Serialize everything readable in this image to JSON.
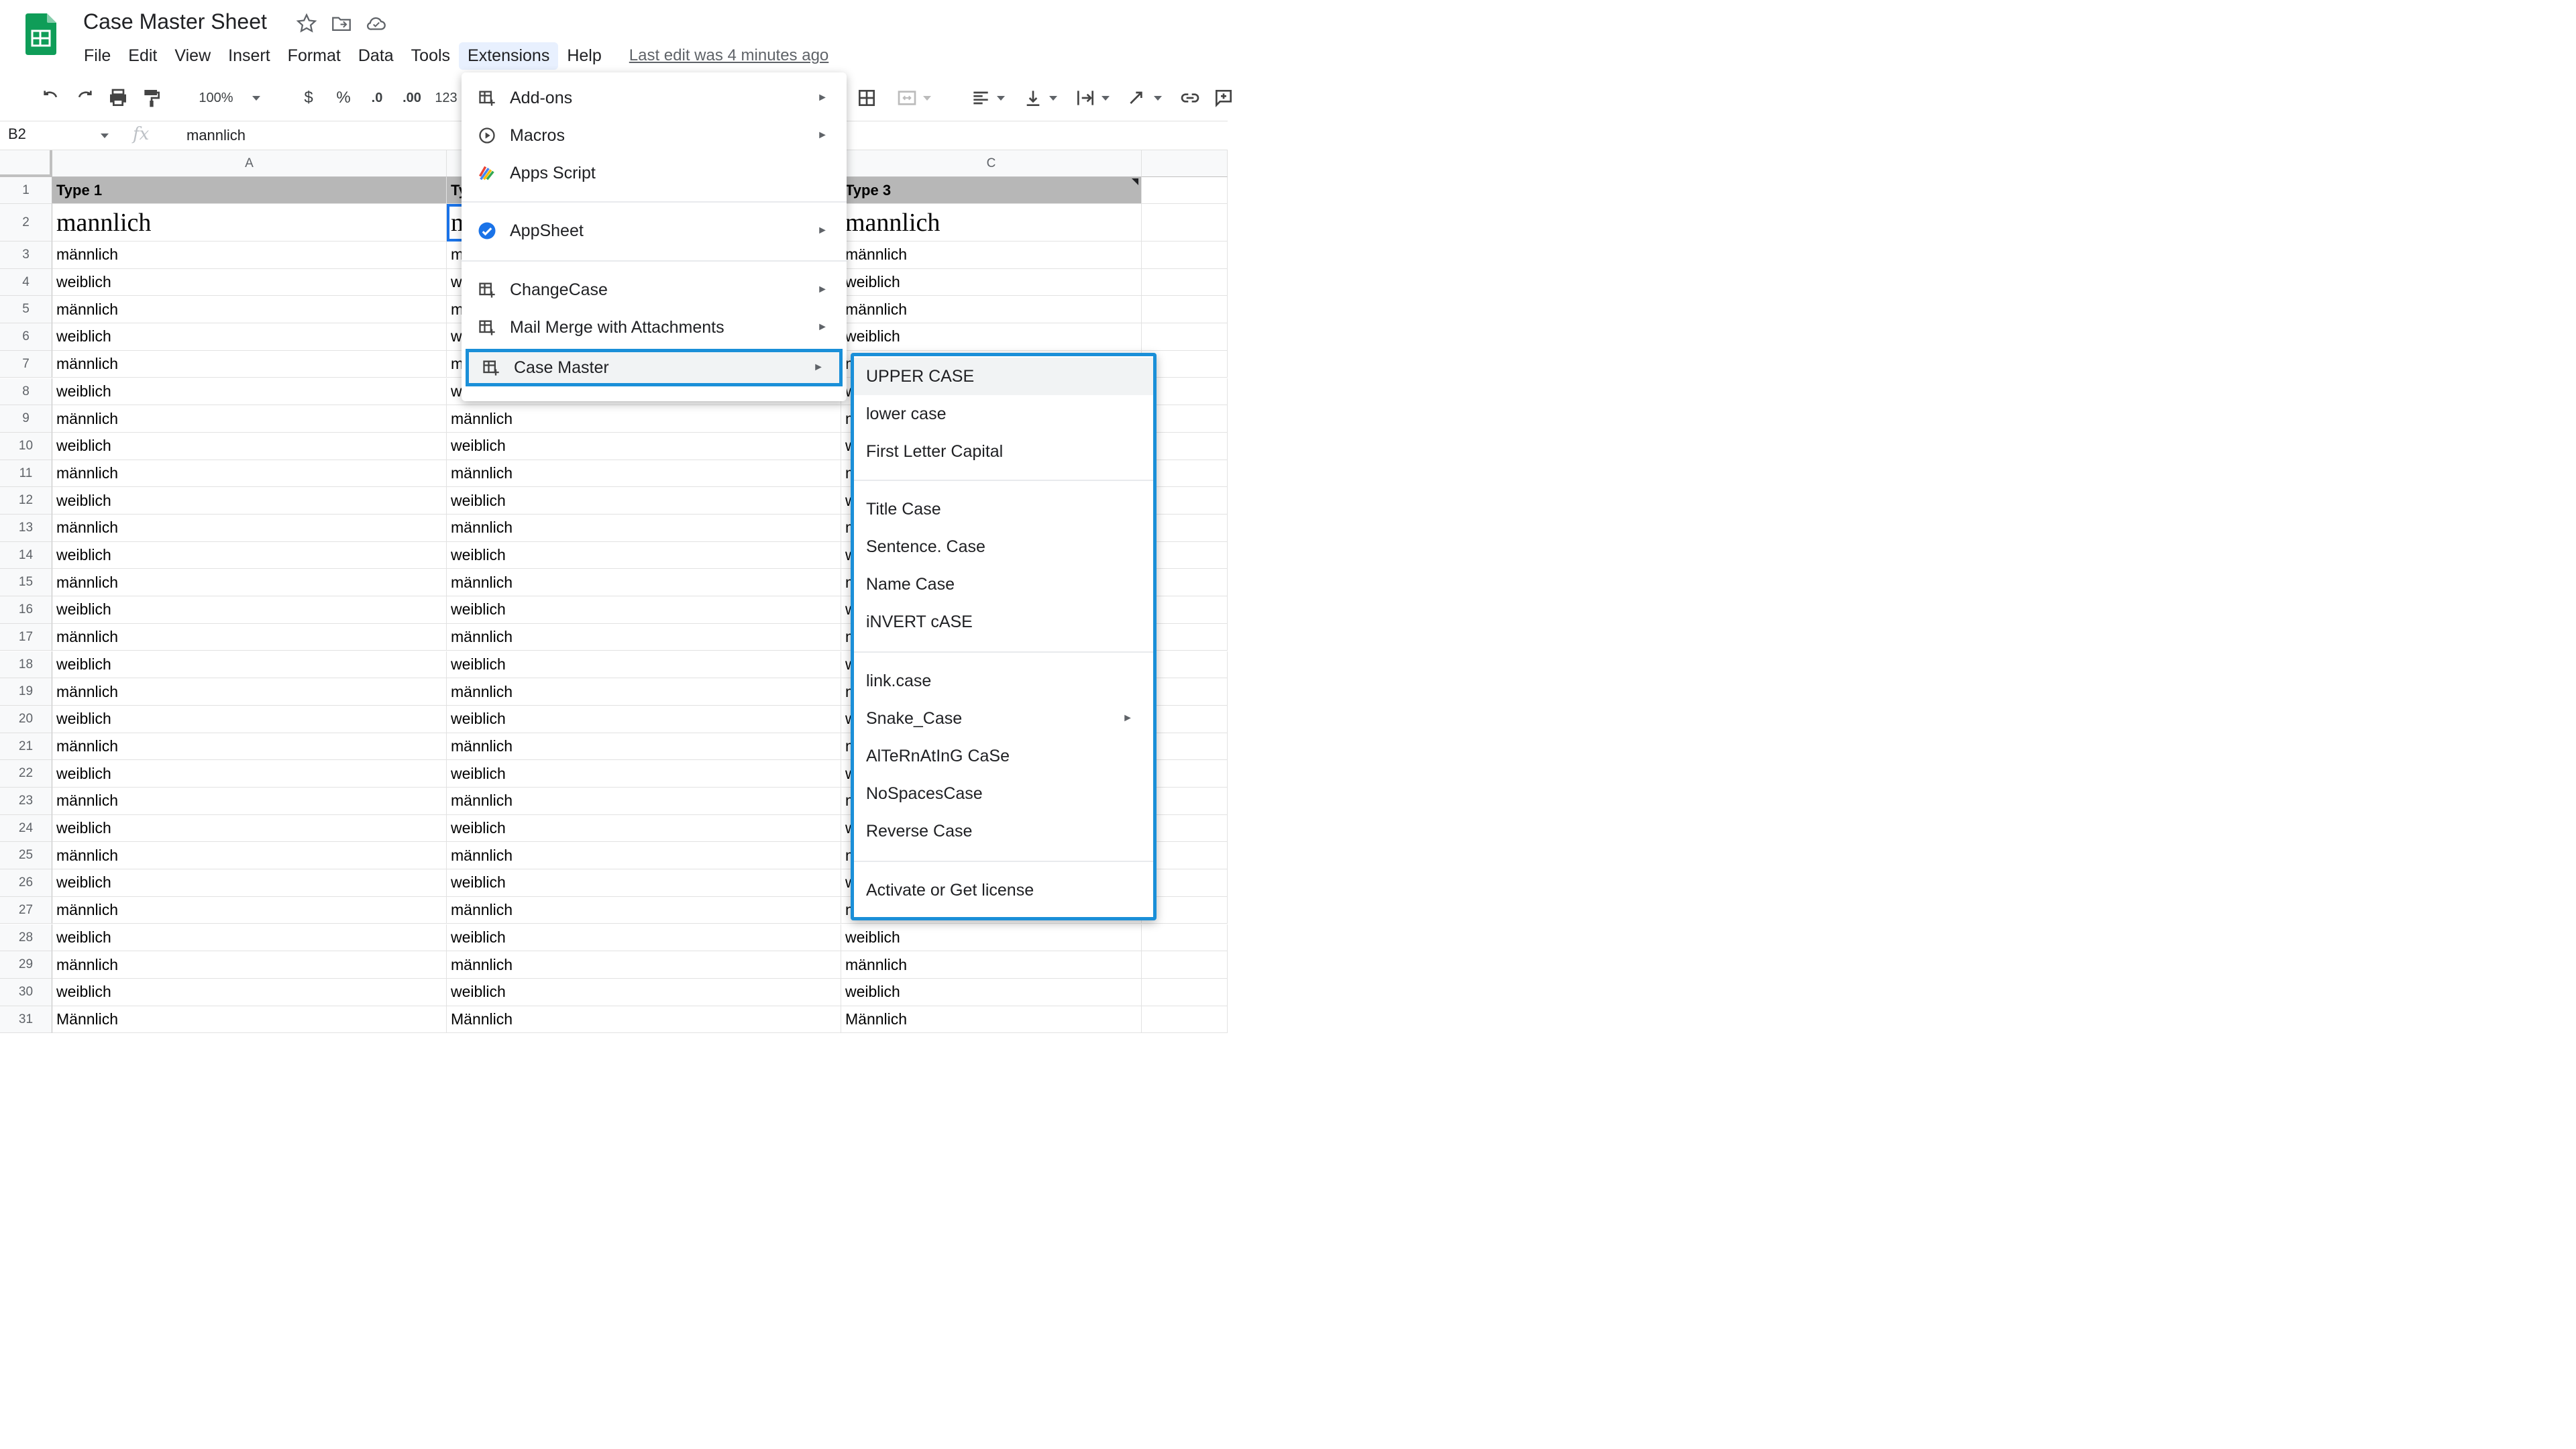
{
  "app": {
    "title": "Case Master Sheet",
    "last_edit": "Last edit was 4 minutes ago"
  },
  "menubar": [
    "File",
    "Edit",
    "View",
    "Insert",
    "Format",
    "Data",
    "Tools",
    "Extensions",
    "Help"
  ],
  "toolbar": {
    "zoom": "100%",
    "currency": "$",
    "percent": "%",
    "decrease_decimal": ".0",
    "increase_decimal": ".00",
    "number_format": "123"
  },
  "formula_bar": {
    "cell_ref": "B2",
    "fx": "fx",
    "value": "mannlich"
  },
  "grid": {
    "columns": [
      "A",
      "B",
      "C"
    ],
    "header_row": [
      "Type 1",
      "Type 2",
      "Type 3"
    ],
    "rows": [
      [
        "mannlich",
        "mannlich",
        "mannlich"
      ],
      [
        "männlich",
        "männlich",
        "männlich"
      ],
      [
        "weiblich",
        "weiblich",
        "weiblich"
      ],
      [
        "männlich",
        "männlich",
        "männlich"
      ],
      [
        "weiblich",
        "weiblich",
        "weiblich"
      ],
      [
        "männlich",
        "männlich",
        "männlich"
      ],
      [
        "weiblich",
        "weiblich",
        "weiblich"
      ],
      [
        "männlich",
        "männlich",
        "männlich"
      ],
      [
        "weiblich",
        "weiblich",
        "weiblich"
      ],
      [
        "männlich",
        "männlich",
        "männlich"
      ],
      [
        "weiblich",
        "weiblich",
        "weiblich"
      ],
      [
        "männlich",
        "männlich",
        "männlich"
      ],
      [
        "weiblich",
        "weiblich",
        "weiblich"
      ],
      [
        "männlich",
        "männlich",
        "männlich"
      ],
      [
        "weiblich",
        "weiblich",
        "weiblich"
      ],
      [
        "männlich",
        "männlich",
        "männlich"
      ],
      [
        "weiblich",
        "weiblich",
        "weiblich"
      ],
      [
        "männlich",
        "männlich",
        "männlich"
      ],
      [
        "weiblich",
        "weiblich",
        "weiblich"
      ],
      [
        "männlich",
        "männlich",
        "männlich"
      ],
      [
        "weiblich",
        "weiblich",
        "weiblich"
      ],
      [
        "männlich",
        "männlich",
        "männlich"
      ],
      [
        "weiblich",
        "weiblich",
        "weiblich"
      ],
      [
        "männlich",
        "männlich",
        "männlich"
      ],
      [
        "weiblich",
        "weiblich",
        "weiblich"
      ],
      [
        "männlich",
        "männlich",
        "männlich"
      ],
      [
        "weiblich",
        "weiblich",
        "weiblich"
      ],
      [
        "männlich",
        "männlich",
        "männlich"
      ],
      [
        "weiblich",
        "weiblich",
        "weiblich"
      ],
      [
        "Männlich",
        "Männlich",
        "Männlich"
      ]
    ]
  },
  "extensions_menu": {
    "items": [
      {
        "label": "Add-ons",
        "icon": "addon-icon",
        "submenu": true
      },
      {
        "label": "Macros",
        "icon": "play-circle-icon",
        "submenu": true
      },
      {
        "label": "Apps Script",
        "icon": "apps-script-icon",
        "submenu": false
      },
      {
        "label": "AppSheet",
        "icon": "appsheet-icon",
        "submenu": true
      },
      {
        "label": "ChangeCase",
        "icon": "addon-icon",
        "submenu": true
      },
      {
        "label": "Mail Merge with Attachments",
        "icon": "addon-icon",
        "submenu": true
      },
      {
        "label": "Case Master",
        "icon": "addon-icon",
        "submenu": true
      }
    ]
  },
  "case_master_menu": {
    "items": [
      "UPPER CASE",
      "lower case",
      "First Letter Capital",
      "Title Case",
      "Sentence. Case",
      "Name Case",
      "iNVERT cASE",
      "link.case",
      "Snake_Case",
      "AlTeRnAtInG CaSe",
      "NoSpacesCase",
      "Reverse Case",
      "Activate or Get license"
    ]
  },
  "colors": {
    "accent": "#1a73e8",
    "highlight_border": "#1a8fd8",
    "header_fill": "#b7b7b7",
    "sheets_green": "#0f9d58"
  }
}
